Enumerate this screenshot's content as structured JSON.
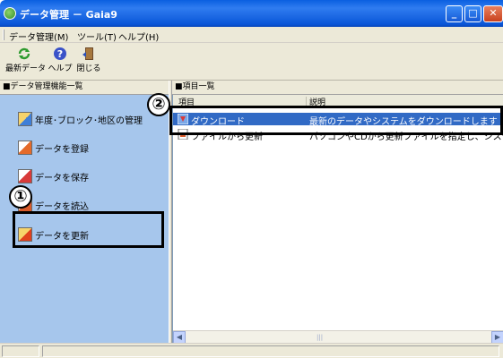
{
  "window": {
    "title": "データ管理 － Gaia9",
    "controls": {
      "minimize": "_",
      "maximize": "□",
      "close": "✕"
    }
  },
  "menu": [
    {
      "label": "データ管理(M)"
    },
    {
      "label": "ツール(T)"
    },
    {
      "label": "ヘルプ(H)"
    }
  ],
  "toolbar": [
    {
      "label": "最新データ",
      "icon": "refresh-icon"
    },
    {
      "label": "ヘルプ",
      "icon": "help-icon"
    },
    {
      "label": "閉じる",
      "icon": "close-door-icon"
    }
  ],
  "left_panel": {
    "header": "■データ管理機能一覧",
    "items": [
      {
        "label": "年度･ブロック･地区の管理",
        "icon": "calendar-grid-icon"
      },
      {
        "label": "データを登録",
        "icon": "register-icon"
      },
      {
        "label": "データを保存",
        "icon": "save-icon"
      },
      {
        "label": "データを読込",
        "icon": "load-icon"
      },
      {
        "label": "データを更新",
        "icon": "update-icon"
      }
    ]
  },
  "right_panel": {
    "header": "■項目一覧",
    "columns": [
      "項目",
      "説明"
    ],
    "rows": [
      {
        "item": "ダウンロード",
        "description": "最新のデータやシステムをダウンロードします",
        "selected": true
      },
      {
        "item": "ファイルから更新",
        "description": "パソコンやCDから更新ファイルを指定し、システムを",
        "selected": false
      }
    ]
  },
  "callouts": [
    {
      "number": "①"
    },
    {
      "number": "②"
    }
  ],
  "colors": {
    "titlebar": "#0a56d8",
    "left_panel_bg": "#a6c6ec",
    "selection": "#316ac5"
  }
}
